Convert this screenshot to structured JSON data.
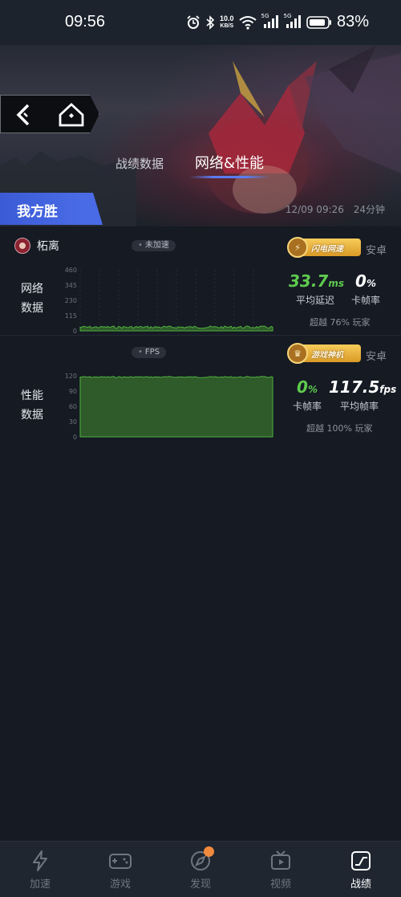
{
  "status_bar": {
    "time": "09:56",
    "net_speed_value": "10.0",
    "net_speed_unit": "KB/S",
    "signal_1": "5G",
    "signal_2": "5G",
    "battery": "83%"
  },
  "header": {
    "tabs": [
      "战绩数据",
      "网络&性能"
    ],
    "active_tab": "网络&性能",
    "result": "我方胜",
    "match_time": "12/09 09:26",
    "duration": "24分钟"
  },
  "player": {
    "name": "柘离"
  },
  "network": {
    "title_line1": "网络",
    "title_line2": "数据",
    "chip": "未加速",
    "y_ticks": [
      "460",
      "345",
      "230",
      "115",
      "0"
    ],
    "badge": "闪电网速",
    "platform": "安卓",
    "latency_value": "33.7",
    "latency_unit": "ms",
    "latency_label": "平均延迟",
    "stutter_value": "0",
    "stutter_unit": "%",
    "stutter_label": "卡帧率",
    "beat": "超越 76% 玩家",
    "chart_level": 0.06
  },
  "performance": {
    "title_line1": "性能",
    "title_line2": "数据",
    "chip": "FPS",
    "y_ticks": [
      "120",
      "90",
      "60",
      "30",
      "0"
    ],
    "badge": "游戏神机",
    "platform": "安卓",
    "stutter_value": "0",
    "stutter_unit": "%",
    "stutter_label": "卡帧率",
    "fps_value": "117.5",
    "fps_unit": "fps",
    "fps_label": "平均帧率",
    "beat": "超越 100% 玩家",
    "chart_level": 0.98
  },
  "bottom_nav": {
    "items": [
      "加速",
      "游戏",
      "发现",
      "视频",
      "战绩"
    ],
    "active": "战绩"
  },
  "colors": {
    "accent_blue": "#4a6be6",
    "metric_green": "#5fcb4e",
    "badge_gold": "#f7cc5a"
  }
}
